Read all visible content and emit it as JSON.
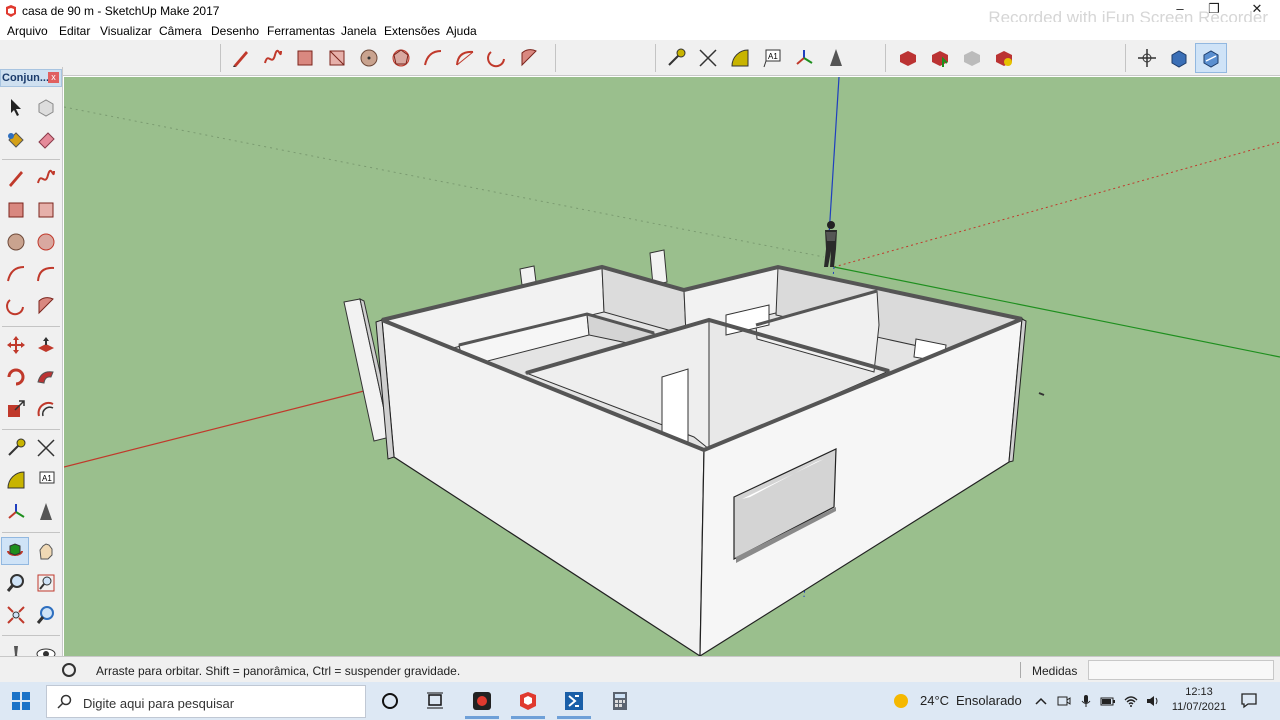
{
  "window": {
    "title": "casa de 90 m - SketchUp Make 2017",
    "watermark": "Recorded with iFun Screen Recorder",
    "controls": [
      "minimize",
      "restore",
      "close"
    ]
  },
  "menu": [
    "Arquivo",
    "Editar",
    "Visualizar",
    "Câmera",
    "Desenho",
    "Ferramentas",
    "Janela",
    "Extensões",
    "Ajuda"
  ],
  "toolbar": {
    "drawing_tools": [
      "pencil-icon",
      "freehand-icon",
      "rectangle-icon",
      "rotated-rectangle-icon",
      "circle-icon",
      "polygon-icon",
      "arc-icon",
      "two-point-arc-icon",
      "three-point-arc-icon",
      "pie-icon"
    ],
    "construction_tools": [
      "tape-measure-icon",
      "dimension-icon",
      "protractor-icon",
      "text-icon",
      "axes-icon",
      "3d-text-icon"
    ],
    "warehouse_tools": [
      "3d-warehouse-icon",
      "share-model-icon",
      "share-component-icon",
      "extension-warehouse-icon"
    ],
    "view_tools": [
      "position-camera-icon",
      "walk-icon",
      "look-around-icon"
    ],
    "active": "look-around-icon"
  },
  "tray": {
    "title": "Conjun...",
    "close_label": "x",
    "tools": [
      [
        "select-icon",
        "component-icon"
      ],
      [
        "paint-bucket-icon",
        "eraser-icon"
      ],
      [
        "pencil-icon",
        "freehand-icon"
      ],
      [
        "rectangle-icon",
        "rotated-rectangle-icon"
      ],
      [
        "circle-icon",
        "polygon-icon"
      ],
      [
        "arc-icon",
        "two-point-arc-icon"
      ],
      [
        "three-point-arc-icon",
        "pie-icon"
      ],
      [
        "move-icon",
        "push-pull-icon"
      ],
      [
        "rotate-icon",
        "follow-me-icon"
      ],
      [
        "scale-icon",
        "offset-icon"
      ],
      [
        "tape-measure-icon",
        "dimension-icon"
      ],
      [
        "protractor-icon",
        "text-icon"
      ],
      [
        "axes-icon",
        "3d-text-icon"
      ],
      [
        "orbit-icon",
        "pan-icon"
      ],
      [
        "zoom-icon",
        "zoom-window-icon"
      ],
      [
        "zoom-extents-icon",
        "previous-view-icon"
      ],
      [
        "walk-icon",
        "look-around-icon"
      ]
    ],
    "active": "orbit-icon"
  },
  "status": {
    "hint": "Arraste para orbitar. Shift = panorâmica, Ctrl = suspender gravidade.",
    "measurements_label": "Medidas",
    "measurements_value": ""
  },
  "taskbar": {
    "search_placeholder": "Digite aqui para pesquisar",
    "apps": [
      "cortana-icon",
      "task-view-icon",
      "screen-recorder-icon",
      "sketchup-icon",
      "app-icon",
      "calculator-icon"
    ],
    "temperature": "24°C",
    "weather": "Ensolarado",
    "time": "12:13",
    "date": "11/07/2021"
  },
  "colors": {
    "sky": "#ffffff",
    "ground": "#9abf8d",
    "wall_face": "#f2f2f2",
    "wall_shade": "#d6d6d6",
    "axis_red": "#c0392b",
    "axis_green": "#1e8f1e",
    "axis_blue": "#1f3fbf"
  }
}
